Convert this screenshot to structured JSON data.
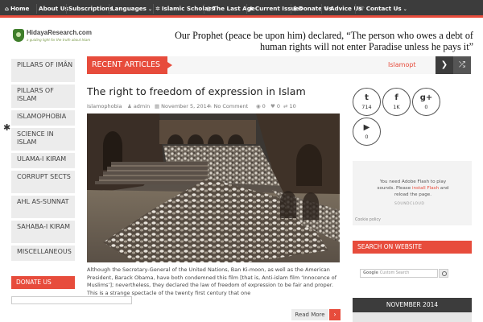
{
  "nav": {
    "items": [
      {
        "icon": "home-icon",
        "glyph": "⌂",
        "label": "Home",
        "has_menu": false
      },
      {
        "icon": "",
        "glyph": "",
        "label": "About Us",
        "has_menu": false
      },
      {
        "icon": "",
        "glyph": "",
        "label": "Subscriptions",
        "has_menu": true
      },
      {
        "icon": "",
        "glyph": "",
        "label": "Languages",
        "has_menu": true
      },
      {
        "icon": "star-icon",
        "glyph": "✲",
        "label": "Islamic Scholars",
        "has_menu": false
      },
      {
        "icon": "clock-icon",
        "glyph": "◷",
        "label": "The Last Age",
        "has_menu": false
      },
      {
        "icon": "gear-icon",
        "glyph": "✱",
        "label": "Current Issues",
        "has_menu": false
      },
      {
        "icon": "dollar-icon",
        "glyph": "$",
        "label": "Donate Us",
        "has_menu": false
      },
      {
        "icon": "comment-icon",
        "glyph": "✎",
        "label": "Advice Us",
        "has_menu": false
      },
      {
        "icon": "contact-icon",
        "glyph": "☏",
        "label": "Contact Us",
        "has_menu": true
      }
    ],
    "menu_glyph": "⌄"
  },
  "header": {
    "logo_name": "HidayaResearch.com",
    "logo_tagline": "a guiding light for the truth about Islam",
    "quote": "Our Prophet (peace be upon him) declared, “The person who owes a debt of human rights will not enter Paradise unless he pays it”"
  },
  "left_sidebar": {
    "items": [
      "Pillars of Imân",
      "Pillars of Islam",
      "Islamophobia",
      "Science in Islam",
      "Ulama-i Kiram",
      "Corrupt Sects",
      "Ahl As-Sunnat",
      "Sahaba-i Kiram",
      "Miscellaneous"
    ],
    "donate_title": "DONATE US",
    "settings_glyph": "✱"
  },
  "recent": {
    "label": "RECENT ARTICLES",
    "ticker": "Islamopt",
    "prev_glyph": "❯",
    "shuffle_glyph": "⤮"
  },
  "article": {
    "title": "The right to freedom of expression in Islam",
    "category": "Islamophobia",
    "author": "admin",
    "date": "November 5, 2014",
    "comments": "No Comment",
    "eye_count": "0",
    "heart_count": "0",
    "share_count": "10",
    "excerpt": "Although the Secretary-General of the United Nations, Ban Ki-moon, as well as the American President, Barack Obama, have both condemned this film [that is, Anti-islam film ‘Innocence of Muslims’]; nevertheless, they declared the law of freedom of expression to be fair and proper. This is a strange spectacle of the twenty first century that one",
    "read_more": "Read More",
    "read_more_arrow": "›"
  },
  "social": [
    {
      "icon": "twitter-icon",
      "glyph": "t",
      "count": "714"
    },
    {
      "icon": "facebook-icon",
      "glyph": "f",
      "count": "1K"
    },
    {
      "icon": "googleplus-icon",
      "glyph": "g+",
      "count": "0"
    },
    {
      "icon": "youtube-icon",
      "glyph": "▶",
      "count": "0"
    }
  ],
  "soundcloud": {
    "line1": "You need Adobe Flash to play",
    "line2": "sounds. Please ",
    "link": "install Flash",
    "line2b": " and",
    "line3": "reload the page.",
    "logo": "SOUNDCLOUD",
    "cookie": "Cookie policy"
  },
  "search": {
    "title": "SEARCH ON WEBSITE",
    "google": "Google",
    "placeholder": "Custom Search"
  },
  "calendar": {
    "title": "NOVEMBER 2014"
  },
  "colors": {
    "accent": "#e74c3c",
    "nav_bg": "#3c3c3c"
  }
}
